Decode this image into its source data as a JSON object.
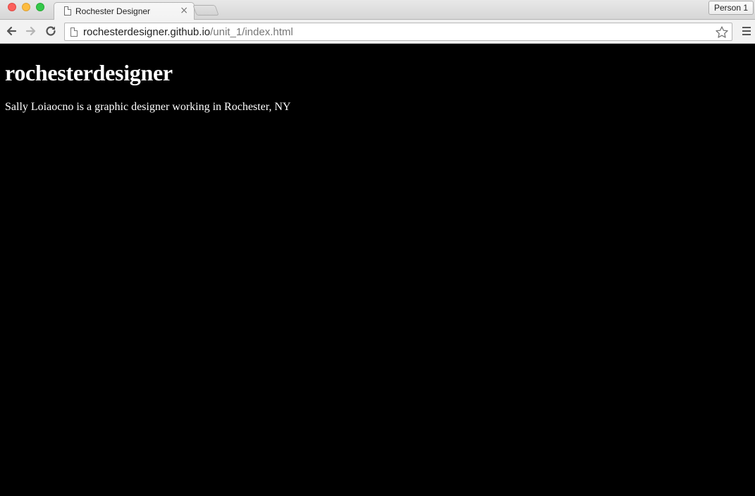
{
  "browser": {
    "tab": {
      "title": "Rochester Designer",
      "close_glyph": "×"
    },
    "profile_label": "Person 1",
    "address": {
      "host": "rochesterdesigner.github.io",
      "path": "/unit_1/index.html"
    }
  },
  "page": {
    "heading": "rochesterdesigner",
    "tagline": "Sally Loiaocno is a graphic designer working in Rochester, NY",
    "background_color": "#000000",
    "text_color": "#ffffff"
  },
  "icons": {
    "back": "back-arrow-icon",
    "forward": "forward-arrow-icon",
    "reload": "reload-icon",
    "bookmark": "star-icon",
    "menu": "hamburger-menu-icon"
  }
}
